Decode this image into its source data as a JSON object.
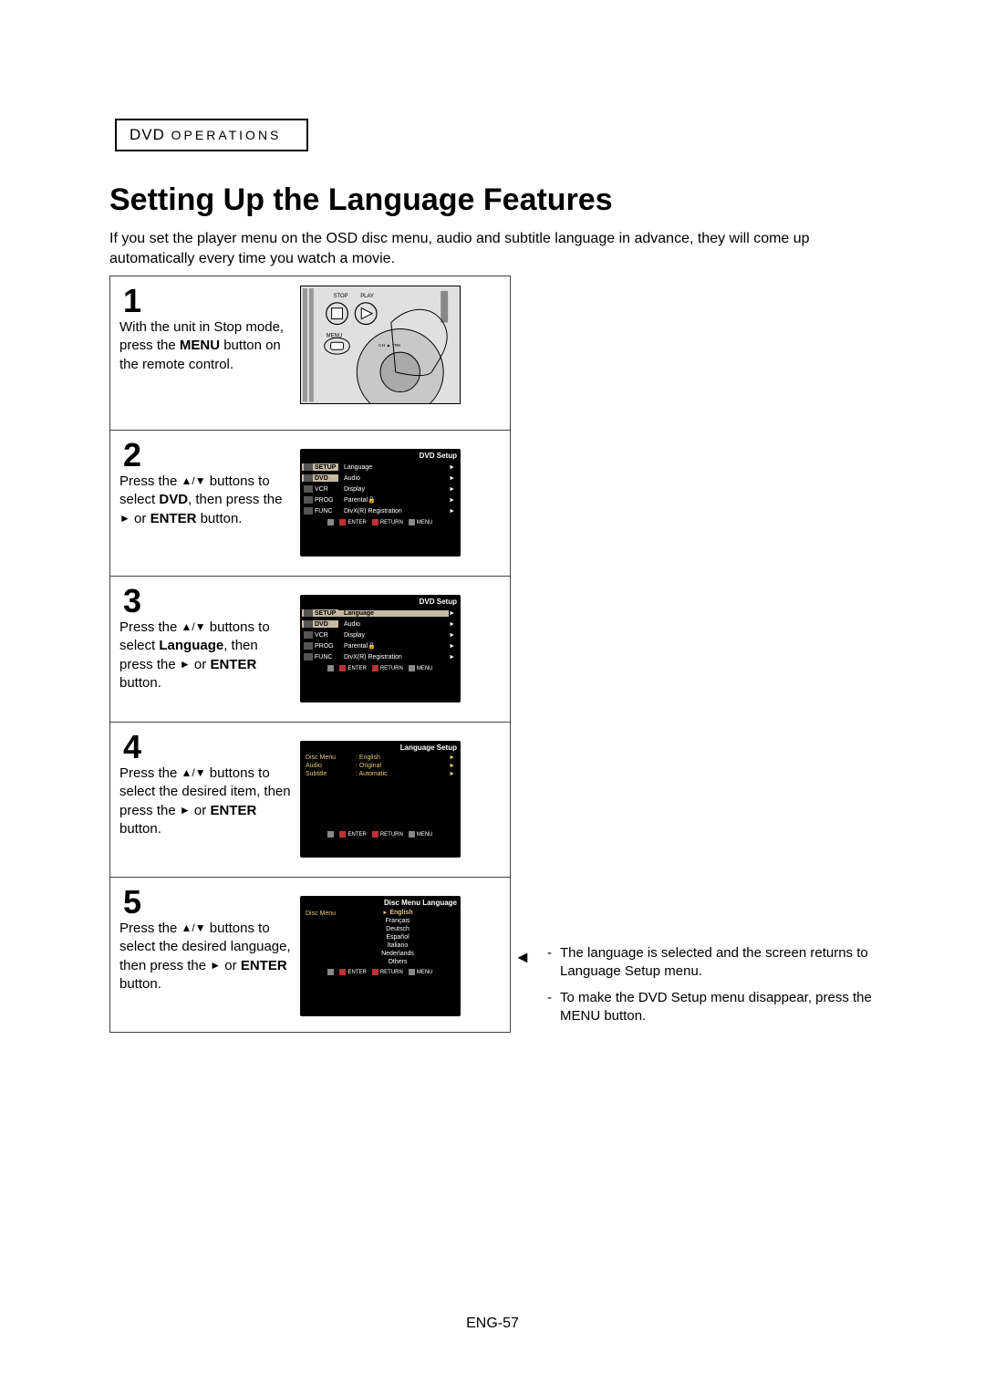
{
  "section_label": {
    "dvd": "DVD",
    "ops": "OPERATIONS"
  },
  "title": "Setting Up the Language Features",
  "intro": "If you set the player menu on the OSD disc menu, audio and subtitle language in advance, they will come up automatically every time you watch a movie.",
  "steps": {
    "s1": {
      "num": "1",
      "text_a": "With the unit in Stop mode, press the ",
      "bold_a": "MENU",
      "text_b": " button on the remote control.",
      "remote_labels": {
        "stop": "STOP",
        "play": "PLAY",
        "menu": "MENU",
        "ch": "CH",
        "trk": "TRK"
      }
    },
    "s2": {
      "num": "2",
      "text_a": "Press the ",
      "text_b": " buttons to select ",
      "bold_a": "DVD",
      "text_c": ", then press the ",
      "text_d": " or ",
      "bold_b": "ENTER",
      "text_e": " button."
    },
    "s3": {
      "num": "3",
      "text_a": "Press the ",
      "text_b": " buttons to select ",
      "bold_a": "Language",
      "text_c": ", then press the ",
      "text_d": " or ",
      "bold_b": "ENTER",
      "text_e": " button."
    },
    "s4": {
      "num": "4",
      "text_a": "Press the ",
      "text_b": " buttons to select the desired item, then press the ",
      "text_c": " or ",
      "bold_a": "ENTER",
      "text_d": " button."
    },
    "s5": {
      "num": "5",
      "text_a": "Press the ",
      "text_b": " buttons to select the desired language, then press the ",
      "text_c": " or ",
      "bold_a": "ENTER",
      "text_d": " button."
    }
  },
  "osd": {
    "dvd_setup_title": "DVD Setup",
    "lang_setup_title": "Language Setup",
    "disc_menu_lang_title": "Disc Menu Language",
    "side_tabs": [
      "SETUP",
      "DVD",
      "VCR",
      "PROG",
      "FUNC"
    ],
    "menu_items": [
      "Language",
      "Audio",
      "Display",
      "Parental",
      "DivX(R) Registration"
    ],
    "hints": {
      "enter": "ENTER",
      "return": "RETURN",
      "menu": "MENU"
    },
    "lang_rows": [
      {
        "label": "Disc Menu",
        "value": "English"
      },
      {
        "label": "Audio",
        "value": "Original"
      },
      {
        "label": "Subtitle",
        "value": "Automatic"
      }
    ],
    "disc_menu_label": "Disc Menu",
    "disc_langs": [
      "English",
      "Français",
      "Deutsch",
      "Español",
      "Italiano",
      "Nederlands",
      "Others"
    ]
  },
  "side_note": {
    "line1": "The language is selected and the screen returns to Language Setup menu.",
    "line2": "To make the DVD Setup menu disappear, press the MENU button."
  },
  "page_num": "ENG-57"
}
